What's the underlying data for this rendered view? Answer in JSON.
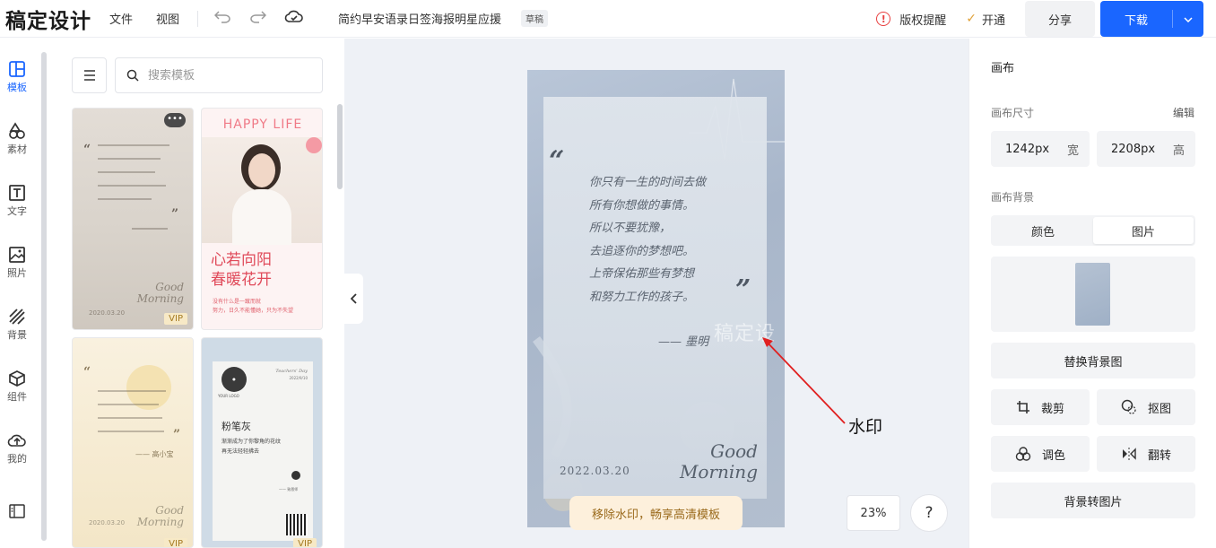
{
  "topbar": {
    "logo": "稿定设计",
    "menu_file": "文件",
    "menu_view": "视图",
    "doc_title": "简约早安语录日签海报明星应援",
    "draft_badge": "草稿",
    "copyright_label": "版权提醒",
    "open_label": "开通",
    "share_label": "分享",
    "download_label": "下载"
  },
  "leftnav": {
    "items": [
      {
        "label": "模板",
        "icon": "layout-icon"
      },
      {
        "label": "素材",
        "icon": "shapes-icon"
      },
      {
        "label": "文字",
        "icon": "text-icon"
      },
      {
        "label": "照片",
        "icon": "image-icon"
      },
      {
        "label": "背景",
        "icon": "stripes-icon"
      },
      {
        "label": "组件",
        "icon": "cube-icon"
      },
      {
        "label": "我的",
        "icon": "upload-cloud-icon"
      }
    ]
  },
  "panel": {
    "search_placeholder": "搜索模板",
    "templates": [
      {
        "good": "Good",
        "morning": "Morning",
        "date": "2020.03.20",
        "badge": "VIP"
      },
      {
        "happy": "HAPPY LIFE",
        "line1": "心若向阳",
        "line2": "春暖花开",
        "sub1": "没有什么是一蹴而就",
        "sub2": "努力，日久不能懂她，只为不失望"
      },
      {
        "good": "Good",
        "morning": "Morning",
        "date": "2020.03.20",
        "author": "—— 高小宝",
        "badge": "VIP"
      },
      {
        "title": "粉笔灰",
        "logo": "YOUR LOGO",
        "day": "Teachers' Day",
        "d": "2022/9/10",
        "text1": "渐渐成为了你黎角的花纹",
        "text2": "再无法轻轻拂去",
        "sign": "—— 致恩师",
        "badge": "VIP"
      }
    ]
  },
  "canvas": {
    "poem_lines": [
      "你只有一生的时间去做",
      "所有你想做的事情。",
      "所以不要犹豫，",
      "去追逐你的梦想吧。",
      "上帝保佑那些有梦想",
      "和努力工作的孩子。"
    ],
    "author": "—— 墨明",
    "watermark": "稿定设",
    "date": "2022.03.20",
    "good": "Good",
    "morning": "Morning",
    "remove_watermark": "移除水印，畅享高清模板",
    "annotation": "水印",
    "zoom": "23%",
    "help": "?"
  },
  "rpanel": {
    "title": "画布",
    "size_label": "画布尺寸",
    "edit_label": "编辑",
    "width_value": "1242px",
    "width_unit": "宽",
    "height_value": "2208px",
    "height_unit": "高",
    "bg_label": "画布背景",
    "tab_color": "颜色",
    "tab_image": "图片",
    "replace_bg": "替换背景图",
    "crop": "裁剪",
    "cutout": "抠图",
    "adjust": "调色",
    "flip": "翻转",
    "bg_to_image": "背景转图片"
  },
  "colors": {
    "accent": "#1a66ff",
    "warning": "#e84040",
    "annotation_arrow": "#e02020"
  }
}
